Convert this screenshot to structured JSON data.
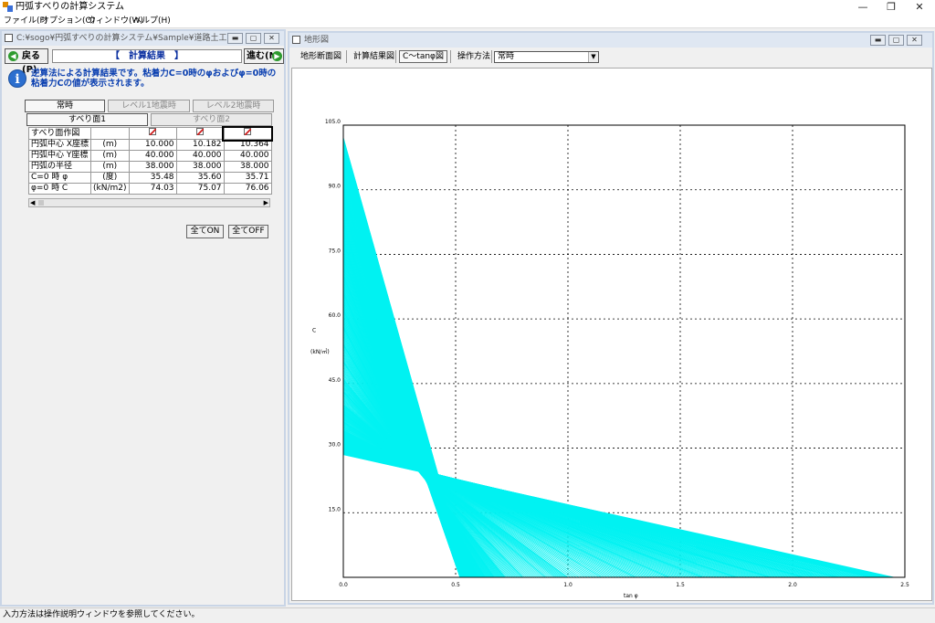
{
  "app": {
    "title": "円弧すべりの計算システム"
  },
  "window_controls": {
    "minimize": "—",
    "restore": "❐",
    "close": "✕"
  },
  "menu": [
    "ファイル(F)",
    "オプション(O)",
    "ウィンドウ(W)",
    "ヘルプ(H)"
  ],
  "left_window": {
    "title": "C:¥sogo¥円弧すべりの計算システム¥Sample¥道路土工　盛土工指...",
    "back_label": "戻る(P)",
    "forward_label": "進む(N)",
    "calc_title": "【　計算結果　】",
    "info_text": "逆算法による計算結果です。粘着力C=0時のφおよびφ=0時の粘着力Cの値が表示されます。",
    "tabs": [
      "常時",
      "レベル1地震時",
      "レベル2地震時"
    ],
    "subtabs": [
      "すべり面1",
      "すべり面2"
    ],
    "table": {
      "rows": [
        {
          "label": "すべり面作図",
          "unit": "",
          "values": [
            "",
            "",
            ""
          ]
        },
        {
          "label": "円弧中心  X座標",
          "unit": "(m)",
          "values": [
            "10.000",
            "10.182",
            "10.364"
          ]
        },
        {
          "label": "円弧中心  Y座標",
          "unit": "(m)",
          "values": [
            "40.000",
            "40.000",
            "40.000"
          ]
        },
        {
          "label": "円弧の半径",
          "unit": "(m)",
          "values": [
            "38.000",
            "38.000",
            "38.000"
          ]
        },
        {
          "label": "C=0 時 φ",
          "unit": "(度)",
          "values": [
            "35.48",
            "35.60",
            "35.71"
          ]
        },
        {
          "label": "φ=0 時 C",
          "unit": "(kN/m2)",
          "values": [
            "74.03",
            "75.07",
            "76.06"
          ]
        }
      ]
    },
    "btn_all_on": "全てON",
    "btn_all_off": "全てOFF"
  },
  "right_window": {
    "title": "地形図",
    "toolbar": [
      "地形断面図",
      "計算結果図",
      "C〜tanφ図",
      "操作方法"
    ],
    "combo_value": "常時"
  },
  "chart_data": {
    "type": "line",
    "xlabel": "tan φ",
    "ylabel": "C",
    "ylabel_unit": "(kN/㎡)",
    "xlim": [
      0.0,
      2.5
    ],
    "ylim": [
      0.0,
      105.0
    ],
    "xticks": [
      "0.0",
      "0.5",
      "1.0",
      "1.5",
      "2.0",
      "2.5"
    ],
    "yticks": [
      "105.0",
      "90.0",
      "75.0",
      "60.0",
      "45.0",
      "30.0",
      "15.0"
    ],
    "grid": true,
    "line_color": "#00f2f2",
    "series": [
      {
        "c_intercept": 102.0,
        "tan_intercept": 0.55
      },
      {
        "c_intercept": 98.0,
        "tan_intercept": 0.54
      },
      {
        "c_intercept": 94.0,
        "tan_intercept": 0.54
      },
      {
        "c_intercept": 90.0,
        "tan_intercept": 0.53
      },
      {
        "c_intercept": 86.0,
        "tan_intercept": 0.53
      },
      {
        "c_intercept": 82.0,
        "tan_intercept": 0.52
      },
      {
        "c_intercept": 78.0,
        "tan_intercept": 0.52
      },
      {
        "c_intercept": 74.0,
        "tan_intercept": 0.54
      },
      {
        "c_intercept": 70.0,
        "tan_intercept": 0.55
      },
      {
        "c_intercept": 66.0,
        "tan_intercept": 0.56
      },
      {
        "c_intercept": 62.0,
        "tan_intercept": 0.58
      },
      {
        "c_intercept": 58.0,
        "tan_intercept": 0.6
      },
      {
        "c_intercept": 54.0,
        "tan_intercept": 0.63
      },
      {
        "c_intercept": 50.0,
        "tan_intercept": 0.67
      },
      {
        "c_intercept": 46.0,
        "tan_intercept": 0.72
      },
      {
        "c_intercept": 43.0,
        "tan_intercept": 0.8
      },
      {
        "c_intercept": 40.0,
        "tan_intercept": 0.9
      },
      {
        "c_intercept": 38.0,
        "tan_intercept": 1.0
      },
      {
        "c_intercept": 36.0,
        "tan_intercept": 1.15
      },
      {
        "c_intercept": 34.0,
        "tan_intercept": 1.3
      },
      {
        "c_intercept": 33.0,
        "tan_intercept": 1.45
      },
      {
        "c_intercept": 32.0,
        "tan_intercept": 1.6
      },
      {
        "c_intercept": 31.0,
        "tan_intercept": 1.75
      },
      {
        "c_intercept": 30.5,
        "tan_intercept": 1.9
      },
      {
        "c_intercept": 30.0,
        "tan_intercept": 2.05
      },
      {
        "c_intercept": 29.5,
        "tan_intercept": 2.2
      },
      {
        "c_intercept": 29.0,
        "tan_intercept": 2.35
      },
      {
        "c_intercept": 28.5,
        "tan_intercept": 2.45
      }
    ]
  },
  "statusbar": "入力方法は操作説明ウィンドウを参照してください。"
}
